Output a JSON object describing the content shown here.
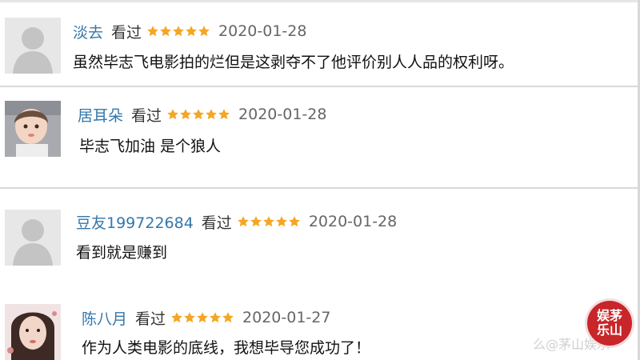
{
  "comments": [
    {
      "username": "淡去",
      "status": "看过",
      "rating": 5,
      "date": "2020-01-28",
      "text": "虽然毕志飞电影拍的烂但是这剥夺不了他评价别人人品的权利呀。",
      "avatar": "default-avatar"
    },
    {
      "username": "居耳朵",
      "status": "看过",
      "rating": 5,
      "date": "2020-01-28",
      "text": "毕志飞加油 是个狼人",
      "avatar": "child-photo-avatar"
    },
    {
      "username": "豆友199722684",
      "status": "看过",
      "rating": 5,
      "date": "2020-01-28",
      "text": "看到就是赚到",
      "avatar": "default-avatar"
    },
    {
      "username": "陈八月",
      "status": "看过",
      "rating": 5,
      "date": "2020-01-27",
      "text": "作为人类电影的底线，我想毕导您成功了！",
      "avatar": "girl-photo-avatar"
    }
  ],
  "watermark": {
    "text": "么@茅山娱乐",
    "stamp": "娱茅乐山"
  },
  "colors": {
    "username": "#3377aa",
    "star": "#f5a623",
    "date": "#666666",
    "stamp": "#c8262a"
  }
}
